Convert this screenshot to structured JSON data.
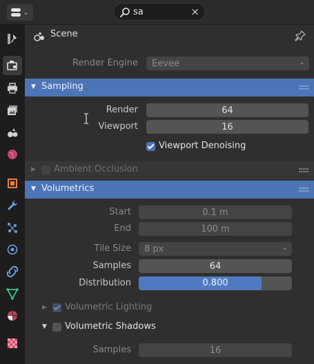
{
  "header": {
    "search_value": "sa",
    "clear_glyph": "×"
  },
  "tabs": [
    {
      "name": "tool-tab",
      "icon": "tool-icon"
    },
    {
      "name": "render-tab",
      "icon": "render-icon",
      "active": true
    },
    {
      "name": "output-tab",
      "icon": "output-icon"
    },
    {
      "name": "view-layer-tab",
      "icon": "view-layer-icon"
    },
    {
      "name": "scene-tab",
      "icon": "scene-icon"
    },
    {
      "name": "world-tab",
      "icon": "world-icon"
    },
    {
      "name": "object-tab",
      "icon": "object-icon"
    },
    {
      "name": "modifier-tab",
      "icon": "wrench-icon"
    },
    {
      "name": "particles-tab",
      "icon": "particles-icon"
    },
    {
      "name": "physics-tab",
      "icon": "physics-icon"
    },
    {
      "name": "constraints-tab",
      "icon": "constraints-icon"
    },
    {
      "name": "data-tab",
      "icon": "mesh-data-icon"
    },
    {
      "name": "material-tab",
      "icon": "material-icon"
    },
    {
      "name": "texture-tab",
      "icon": "texture-icon"
    }
  ],
  "scene": {
    "title": "Scene"
  },
  "render_engine": {
    "label": "Render Engine",
    "value": "Eevee"
  },
  "sampling": {
    "title": "Sampling",
    "render_label": "Render",
    "render_value": "64",
    "viewport_label": "Viewport",
    "viewport_value": "16",
    "denoise_label": "Viewport Denoising",
    "denoise_checked": true
  },
  "ambient_occlusion": {
    "title": "Ambient Occlusion"
  },
  "volumetrics": {
    "title": "Volumetrics",
    "start_label": "Start",
    "start_value": "0.1 m",
    "end_label": "End",
    "end_value": "100 m",
    "tile_label": "Tile Size",
    "tile_value": "8 px",
    "samples_label": "Samples",
    "samples_value": "64",
    "distribution_label": "Distribution",
    "distribution_value": "0.800",
    "distribution_fraction": 0.8,
    "lighting_label": "Volumetric Lighting",
    "shadows_label": "Volumetric Shadows",
    "shadow_samples_label": "Samples",
    "shadow_samples_value": "16"
  },
  "colors": {
    "accent": "#4d74b6",
    "panel": "#2f2f2f",
    "field": "#545454"
  }
}
